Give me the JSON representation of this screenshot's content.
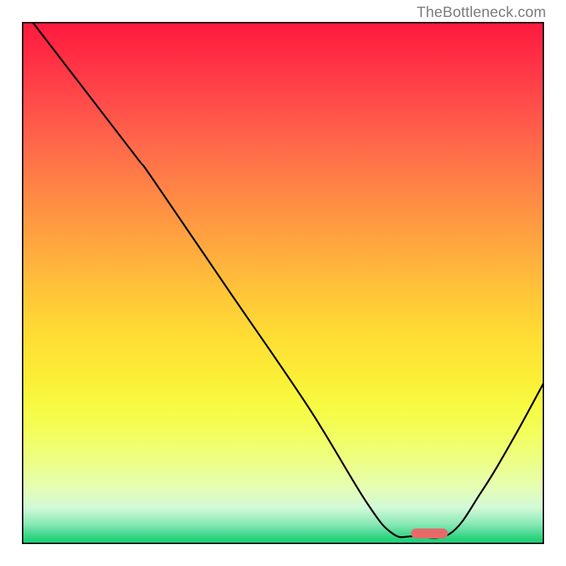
{
  "watermark": "TheBottleneck.com",
  "chart_data": {
    "type": "line",
    "title": "",
    "xlabel": "",
    "ylabel": "",
    "xlim": [
      0,
      100
    ],
    "ylim": [
      0,
      100
    ],
    "grid": false,
    "curve_points": [
      {
        "x": 2,
        "y": 100
      },
      {
        "x": 12,
        "y": 87
      },
      {
        "x": 22,
        "y": 74
      },
      {
        "x": 25,
        "y": 70
      },
      {
        "x": 40,
        "y": 48
      },
      {
        "x": 55,
        "y": 26
      },
      {
        "x": 66,
        "y": 8
      },
      {
        "x": 71,
        "y": 2
      },
      {
        "x": 75,
        "y": 1.5
      },
      {
        "x": 82,
        "y": 2
      },
      {
        "x": 88,
        "y": 10
      },
      {
        "x": 94,
        "y": 20
      },
      {
        "x": 100,
        "y": 31
      }
    ],
    "marker": {
      "x": 78,
      "y": 2,
      "color": "#e66a6a"
    },
    "gradient_stops": [
      {
        "pos": 0,
        "color": "#ff1a3e"
      },
      {
        "pos": 50,
        "color": "#ffc239"
      },
      {
        "pos": 80,
        "color": "#f3fe5e"
      },
      {
        "pos": 100,
        "color": "#1ccf77"
      }
    ]
  }
}
